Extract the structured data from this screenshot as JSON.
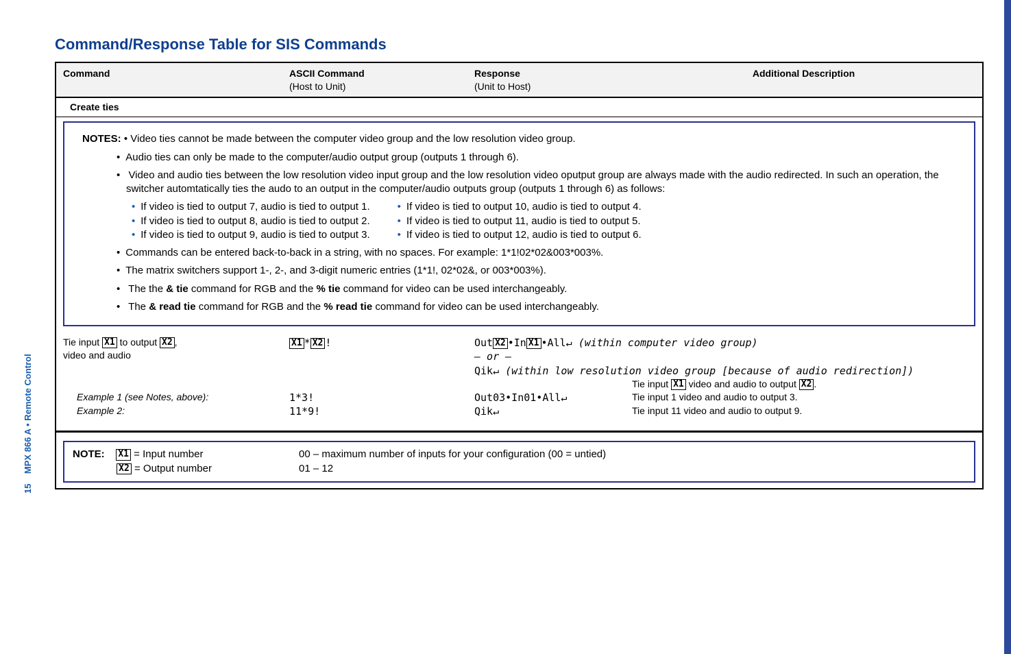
{
  "side_label": "MPX 866 A • Remote Control",
  "page_number": "15",
  "section_title": "Command/Response Table for SIS Commands",
  "header": {
    "command": "Command",
    "ascii": "ASCII Command",
    "ascii_sub": "(Host to Unit)",
    "response": "Response",
    "response_sub": "(Unit to Host)",
    "additional": "Additional Description"
  },
  "subsection": "Create ties",
  "notes": {
    "label": "NOTES:",
    "bul1_pre": "• ",
    "bul1": "Video ties cannot be made between the computer video group and the low resolution video group.",
    "bul2": "Audio ties can only be made to the computer/audio output group (outputs 1 through 6).",
    "bul3": "Video and audio ties between the low resolution video input group and the low resolution video oputput group are always made with the audio redirected. In such an operation, the switcher automtatically ties the audo to an output in the computer/audio outputs group (outputs 1 through 6) as follows:",
    "sub_left": [
      "If video is tied to output 7, audio is tied to output 1.",
      "If video is tied to output 8, audio is tied to output 2.",
      "If video is tied to output 9, audio is tied to output 3."
    ],
    "sub_right": [
      "If video is tied to output 10, audio is tied to output 4.",
      "If video is tied to output 11, audio is tied to output 5.",
      "If video is tied to output 12, audio is tied to output 6."
    ],
    "bul4": "Commands can be entered back-to-back in a string, with no spaces. For example: 1*1!02*02&003*003%.",
    "bul5": "The matrix switchers support 1-, 2-, and 3-digit numeric entries (1*1!, 02*02&, or 003*003%).",
    "bul6_a": "The the ",
    "bul6_b": "& tie",
    "bul6_c": " command for RGB and the ",
    "bul6_d": "% tie",
    "bul6_e": " command for video can be used interchangeably.",
    "bul7_a": "The ",
    "bul7_b": "& read tie",
    "bul7_c": " command for RGB and the ",
    "bul7_d": "% read tie",
    "bul7_e": " command for video can be used interchangeably."
  },
  "row1": {
    "cmd_a": "Tie input ",
    "cmd_b": " to output ",
    "cmd_c": ",",
    "cmd_line2": "video and audio",
    "ascii_mid": "*",
    "ascii_end": "!",
    "resp_out": "Out",
    "resp_in": "•In",
    "resp_all": "•All↵ ",
    "resp_note": "(within computer video group)",
    "resp_or": "— or —",
    "resp_qik": "Qik↵ ",
    "resp_qik_note": "(within low resolution video group [because of audio redirection])",
    "desc_a": "Tie input ",
    "desc_b": " video and audio to output ",
    "desc_c": "."
  },
  "row2a": {
    "cmd": "Example 1 (see Notes, above):",
    "ascii": "1*3!",
    "resp": "Out03•In01•All↵",
    "desc": "Tie input 1 video and audio to output 3."
  },
  "row2b": {
    "cmd": "Example 2:",
    "ascii": "11*9!",
    "resp": "Qik↵",
    "desc": "Tie input 11 video and audio to output 9."
  },
  "legend": {
    "note": "NOTE:",
    "x1": " = Input number",
    "x2": " = Output number",
    "range1": "00 – maximum number of inputs for your configuration (00 = untied)",
    "range2": "01 – 12"
  },
  "vars": {
    "x1": "X1",
    "x2": "X2"
  }
}
